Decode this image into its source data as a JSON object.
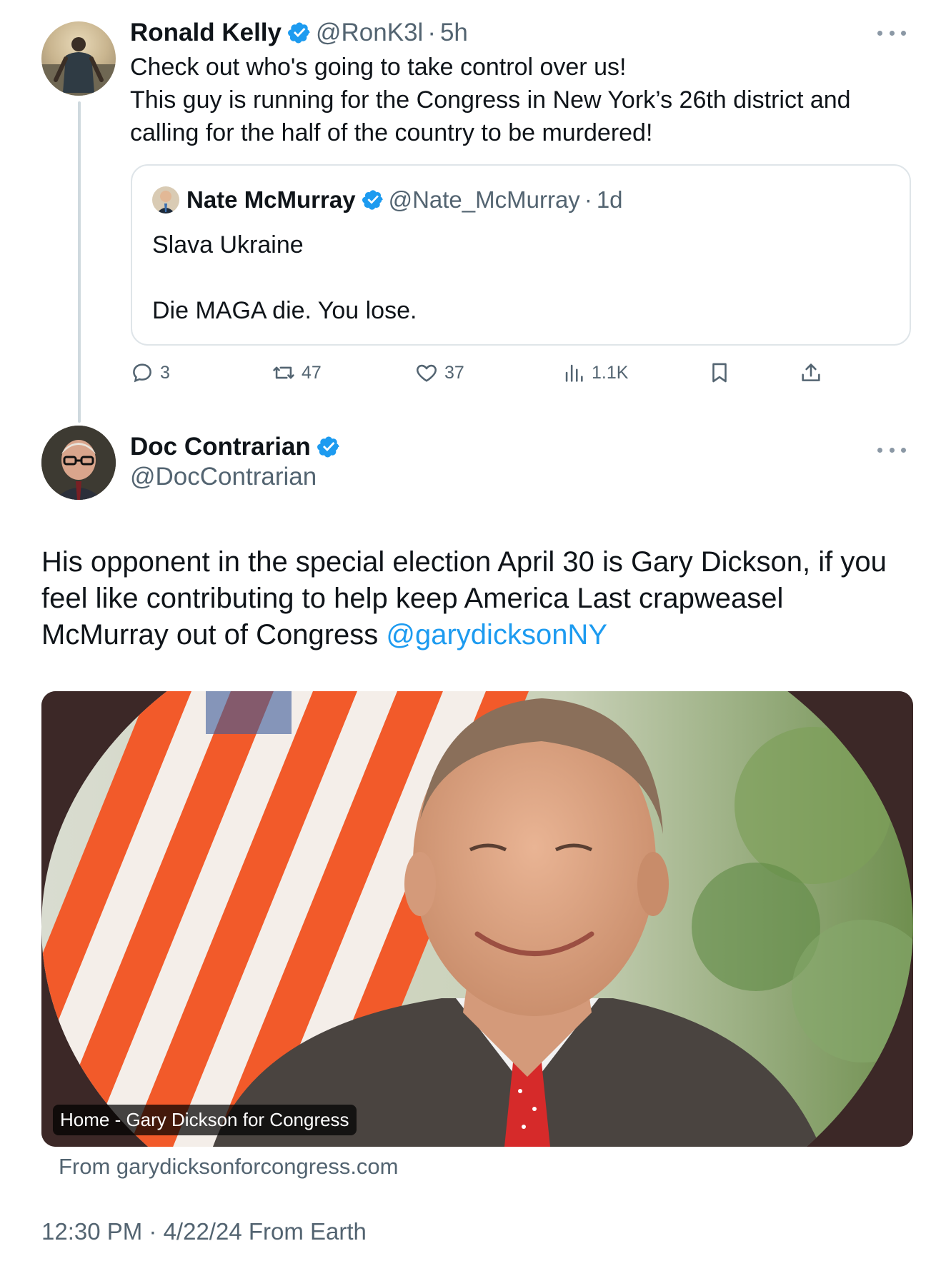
{
  "colors": {
    "accent": "#1d9bf0",
    "text": "#0f1419",
    "muted": "#536471",
    "border": "#dfe5e9"
  },
  "reply_tweet": {
    "author_name": "Ronald Kelly",
    "handle": "@RonK3l",
    "separator": "·",
    "time": "5h",
    "text_line1": "Check out who's going to take control over us!",
    "text_line2": "This guy is running for the Congress in New York’s 26th district and calling for the half of the country to be murdered!",
    "quote": {
      "author_name": "Nate McMurray",
      "handle": "@Nate_McMurray",
      "separator": "·",
      "time": "1d",
      "line1": "Slava Ukraine",
      "line2": "Die MAGA die. You lose."
    },
    "actions": {
      "replies": "3",
      "reposts": "47",
      "likes": "37",
      "views": "1.1K"
    }
  },
  "main_tweet": {
    "author_name": "Doc Contrarian",
    "handle": "@DocContrarian",
    "text": "His opponent in the special election April 30 is Gary Dickson, if you feel like contributing to help keep America Last crapweasel McMurray out of Congress ",
    "mention": "@garydicksonNY",
    "card": {
      "label": "Home - Gary Dickson for Congress",
      "source": "From garydicksonforcongress.com"
    },
    "timestamp": "12:30 PM · 4/22/24 From Earth"
  },
  "icons": {
    "verified": "verified-badge-icon",
    "more": "more-dots-icon",
    "reply": "reply-icon",
    "repost": "repost-icon",
    "like": "heart-icon",
    "views": "views-icon",
    "bookmark": "bookmark-icon",
    "share": "share-icon"
  }
}
